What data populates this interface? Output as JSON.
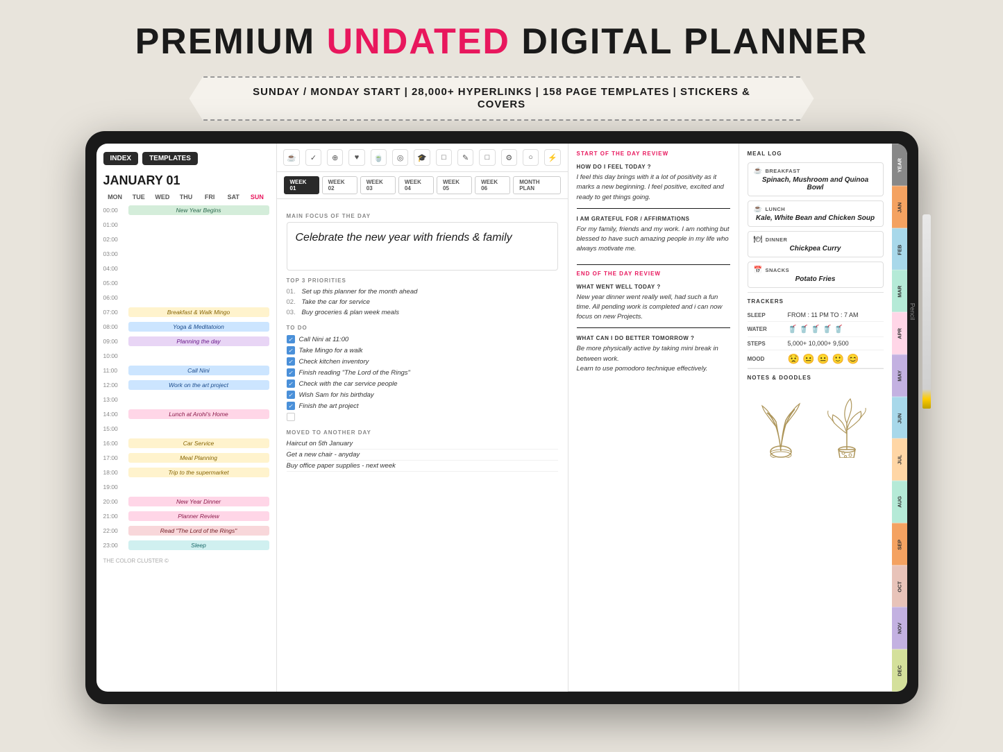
{
  "header": {
    "title_part1": "PREMIUM ",
    "title_highlight": "UNDATED",
    "title_part2": " DIGITAL PLANNER",
    "banner": "SUNDAY / MONDAY START | 28,000+ HYPERLINKS | 158 PAGE TEMPLATES | STICKERS & COVERS"
  },
  "nav_buttons": [
    "INDEX",
    "TEMPLATES"
  ],
  "date": "JANUARY 01",
  "days_header": [
    "MON",
    "TUE",
    "WED",
    "THU",
    "FRI",
    "SAT",
    "SUN"
  ],
  "schedule": [
    {
      "time": "00:00",
      "event": "New Year Begins",
      "style": "green"
    },
    {
      "time": "01:00",
      "event": "",
      "style": ""
    },
    {
      "time": "02:00",
      "event": "",
      "style": ""
    },
    {
      "time": "03:00",
      "event": "",
      "style": ""
    },
    {
      "time": "04:00",
      "event": "",
      "style": ""
    },
    {
      "time": "05:00",
      "event": "",
      "style": ""
    },
    {
      "time": "06:00",
      "event": "",
      "style": ""
    },
    {
      "time": "07:00",
      "event": "Breakfast & Walk Mingo",
      "style": "yellow"
    },
    {
      "time": "08:00",
      "event": "Yoga & Meditatoion",
      "style": "blue"
    },
    {
      "time": "09:00",
      "event": "Planning the day",
      "style": "purple"
    },
    {
      "time": "10:00",
      "event": "",
      "style": ""
    },
    {
      "time": "11:00",
      "event": "Call Nini",
      "style": "blue"
    },
    {
      "time": "12:00",
      "event": "Work on the art project",
      "style": "blue"
    },
    {
      "time": "13:00",
      "event": "",
      "style": ""
    },
    {
      "time": "14:00",
      "event": "Lunch at Arohi's Home",
      "style": "pink"
    },
    {
      "time": "15:00",
      "event": "",
      "style": ""
    },
    {
      "time": "16:00",
      "event": "Car Service",
      "style": "yellow"
    },
    {
      "time": "17:00",
      "event": "Meal Planning",
      "style": "yellow"
    },
    {
      "time": "18:00",
      "event": "Trip to the supermarket",
      "style": "yellow"
    },
    {
      "time": "19:00",
      "event": "",
      "style": ""
    },
    {
      "time": "20:00",
      "event": "New Year Dinner",
      "style": "pink"
    },
    {
      "time": "21:00",
      "event": "Planner Review",
      "style": "pink"
    },
    {
      "time": "22:00",
      "event": "Read \"The Lord of the Rings\"",
      "style": "red"
    },
    {
      "time": "23:00",
      "event": "Sleep",
      "style": "teal"
    }
  ],
  "watermark": "THE COLOR CLUSTER ©",
  "icon_bar": [
    "☕",
    "✓",
    "⊕",
    "♥",
    "☕",
    "◎",
    "🎓",
    "□",
    "✎",
    "□",
    "⚙",
    "○",
    "⚡"
  ],
  "week_tabs": [
    "WEEK 01",
    "WEEK 02",
    "WEEK 03",
    "WEEK 04",
    "WEEK 05",
    "WEEK 06",
    "MONTH PLAN"
  ],
  "main_focus_label": "MAIN FOCUS OF THE DAY",
  "main_focus": "Celebrate the new year with friends & family",
  "priorities_label": "TOP 3 PRIORITIES",
  "priorities": [
    {
      "num": "01.",
      "text": "Set up this planner for the month ahead"
    },
    {
      "num": "02.",
      "text": "Take the car for service"
    },
    {
      "num": "03.",
      "text": "Buy groceries & plan week meals"
    }
  ],
  "todo_label": "TO DO",
  "todos": [
    {
      "text": "Call Nini at 11:00",
      "checked": true
    },
    {
      "text": "Take Mingo for a walk",
      "checked": true
    },
    {
      "text": "Check kitchen inventory",
      "checked": true
    },
    {
      "text": "Finish reading \"The Lord of the Rings\"",
      "checked": true
    },
    {
      "text": "Check with the car service people",
      "checked": true
    },
    {
      "text": "Wish Sam for his birthday",
      "checked": true
    },
    {
      "text": "Finish the art project",
      "checked": true
    },
    {
      "text": "",
      "checked": false
    }
  ],
  "moved_label": "MOVED TO ANOTHER DAY",
  "moved_items": [
    "Haircut on 5th January",
    "Get a new chair - anyday",
    "Buy office paper supplies - next week"
  ],
  "review_label": "START OF THE DAY REVIEW",
  "feel_q": "HOW DO I FEEL TODAY ?",
  "feel_text": "I feel this day brings with it a lot of positivity as it marks a new beginning. I feel positive, excited and ready to get things going.",
  "grateful_q": "I AM GRATEFUL FOR / AFFIRMATIONS",
  "grateful_text": "For my family, friends and my work. I am nothing but blessed to have such amazing people in my life who always motivate me.",
  "end_review_label": "END OF THE DAY REVIEW",
  "went_well_q": "WHAT WENT WELL TODAY ?",
  "went_well_text": "New year dinner went really well, had such a fun time. All pending work is completed and i can now focus on new Projects.",
  "better_q": "WHAT CAN I DO BETTER TOMORROW ?",
  "better_text": "Be more physically active by taking mini break in between work.\nLearn to use pomodoro technique effectively.",
  "meal_label": "MEAL LOG",
  "meals": [
    {
      "type": "BREAKFAST",
      "icon": "☕",
      "name": "Spinach, Mushroom and Quinoa Bowl"
    },
    {
      "type": "LUNCH",
      "icon": "☕",
      "name": "Kale, White Bean and Chicken Soup"
    },
    {
      "type": "DINNER",
      "icon": "🍽",
      "name": "Chickpea Curry"
    },
    {
      "type": "SNACKS",
      "icon": "📅",
      "name": "Potato Fries"
    }
  ],
  "trackers_label": "TRACKERS",
  "trackers": {
    "sleep": {
      "name": "SLEEP",
      "value": "FROM : 11 PM  TO : 7 AM"
    },
    "water": {
      "name": "WATER",
      "cups": 5
    },
    "steps": {
      "name": "STEPS",
      "value": "5,000+  10,000+  9,500"
    },
    "mood": {
      "name": "MOOD",
      "icons": [
        "😟",
        "😐",
        "😐",
        "🙂",
        "😊"
      ]
    }
  },
  "notes_label": "NOTES & DOODLES",
  "months": [
    "YEAR",
    "JAN",
    "FEB",
    "MAR",
    "APR",
    "MAY",
    "JUN",
    "JUL",
    "AUG",
    "SEP",
    "OCT",
    "NOV",
    "DEC"
  ],
  "month_colors": [
    "#888",
    "#f4a261",
    "#a8d8ea",
    "#b5ead7",
    "#ffd6e7",
    "#c3b1e1",
    "#a8d8ea",
    "#ffd6a5",
    "#b5ead7",
    "#f4a261",
    "#e8c3b9",
    "#c3b1e1",
    "#d4e09b"
  ]
}
